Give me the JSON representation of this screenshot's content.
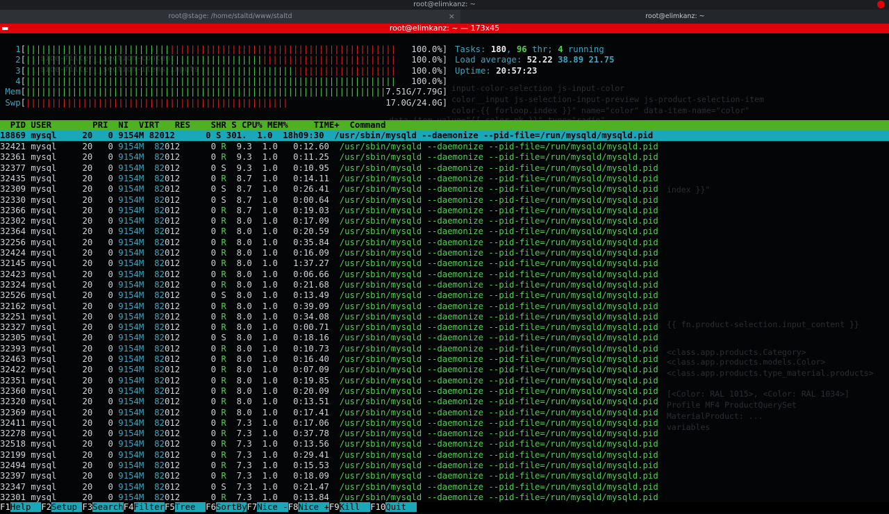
{
  "window_title": "root@elimkanz: ~",
  "tabs": [
    {
      "label": "root@stage: /home/staltd/www/staltd",
      "close": "×"
    },
    {
      "label": "root@elimkanz: ~"
    }
  ],
  "terminal_title": "root@elimkanz: ~ — 173x45",
  "colors": {
    "accent_green": "#4fb024",
    "accent_cyan": "#1aa7b7",
    "title_red": "#e0000a",
    "bar_green": "#4fd04f",
    "bar_red": "#e02222"
  },
  "meters": [
    {
      "label": "1",
      "green_frac": 0.39,
      "total_frac": 1.0,
      "value": "100.0%"
    },
    {
      "label": "2",
      "green_frac": 0.64,
      "total_frac": 1.0,
      "value": "100.0%"
    },
    {
      "label": "3",
      "green_frac": 0.72,
      "total_frac": 1.0,
      "value": "100.0%"
    },
    {
      "label": "4",
      "green_frac": 1.0,
      "total_frac": 1.0,
      "value": "100.0%"
    },
    {
      "label": "Mem",
      "green_frac": 1.0,
      "total_frac": 0.97,
      "value": "7.51G/7.79G"
    },
    {
      "label": "Swp",
      "green_frac": 0.0,
      "total_frac": 0.71,
      "value": "17.0G/24.0G"
    }
  ],
  "stats": {
    "tasks_label": "Tasks: ",
    "tasks": "180",
    "sep1": ", ",
    "thr": "96",
    "thr_label": " thr; ",
    "running": "4",
    "running_label": " running",
    "load_label": "Load average: ",
    "load1": "52.22",
    "load5": "38.89",
    "load15": "21.75",
    "uptime_label": "Uptime: ",
    "uptime": "20:57:23"
  },
  "columns": [
    "PID",
    "USER",
    "PRI",
    "NI",
    "VIRT",
    "RES",
    "SHR",
    "S",
    "CPU%",
    "MEM%",
    "TIME+",
    "Command"
  ],
  "selected": {
    "pid": "18869",
    "user": "mysql",
    "pri": "20",
    "ni": "0",
    "virt": "9154M",
    "res": "82012",
    "shr": "0",
    "s": "S",
    "cpu": "301.",
    "mem": "1.0",
    "time": "18h09:30",
    "cmd": "/usr/sbin/mysqld --daemonize --pid-file=/run/mysqld/mysqld.pid"
  },
  "command": "/usr/sbin/mysqld --daemonize --pid-file=/run/mysqld/mysqld.pid",
  "user": "mysql",
  "pri": "20",
  "ni": "0",
  "virt": "9154M",
  "res_a": "82",
  "res_b": "012",
  "shr": "0",
  "mem": "1.0",
  "processes": [
    {
      "pid": "32421",
      "s": "R",
      "cpu": "9.3",
      "time": "0:12.60"
    },
    {
      "pid": "32361",
      "s": "R",
      "cpu": "9.3",
      "time": "0:11.25"
    },
    {
      "pid": "32377",
      "s": "S",
      "cpu": "9.3",
      "time": "0:10.95"
    },
    {
      "pid": "32435",
      "s": "R",
      "cpu": "8.7",
      "time": "0:14.11"
    },
    {
      "pid": "32309",
      "s": "S",
      "cpu": "8.7",
      "time": "0:26.41"
    },
    {
      "pid": "32330",
      "s": "S",
      "cpu": "8.7",
      "time": "0:00.64"
    },
    {
      "pid": "32366",
      "s": "R",
      "cpu": "8.7",
      "time": "0:19.03"
    },
    {
      "pid": "32302",
      "s": "R",
      "cpu": "8.0",
      "time": "0:17.09"
    },
    {
      "pid": "32364",
      "s": "R",
      "cpu": "8.0",
      "time": "0:20.59"
    },
    {
      "pid": "32256",
      "s": "R",
      "cpu": "8.0",
      "time": "0:35.84"
    },
    {
      "pid": "32424",
      "s": "R",
      "cpu": "8.0",
      "time": "0:16.09"
    },
    {
      "pid": "32145",
      "s": "R",
      "cpu": "8.0",
      "time": "1:37.27"
    },
    {
      "pid": "32423",
      "s": "R",
      "cpu": "8.0",
      "time": "0:06.66"
    },
    {
      "pid": "32324",
      "s": "R",
      "cpu": "8.0",
      "time": "0:21.68"
    },
    {
      "pid": "32526",
      "s": "S",
      "cpu": "8.0",
      "time": "0:13.49"
    },
    {
      "pid": "32162",
      "s": "R",
      "cpu": "8.0",
      "time": "0:39.09"
    },
    {
      "pid": "32251",
      "s": "R",
      "cpu": "8.0",
      "time": "0:34.08"
    },
    {
      "pid": "32327",
      "s": "R",
      "cpu": "8.0",
      "time": "0:00.71"
    },
    {
      "pid": "32305",
      "s": "S",
      "cpu": "8.0",
      "time": "0:18.16"
    },
    {
      "pid": "32393",
      "s": "R",
      "cpu": "8.0",
      "time": "0:10.73"
    },
    {
      "pid": "32463",
      "s": "R",
      "cpu": "8.0",
      "time": "0:16.40"
    },
    {
      "pid": "32422",
      "s": "R",
      "cpu": "8.0",
      "time": "0:07.09"
    },
    {
      "pid": "32351",
      "s": "R",
      "cpu": "8.0",
      "time": "0:19.85"
    },
    {
      "pid": "32360",
      "s": "R",
      "cpu": "8.0",
      "time": "0:20.09"
    },
    {
      "pid": "32320",
      "s": "R",
      "cpu": "8.0",
      "time": "0:13.51"
    },
    {
      "pid": "32369",
      "s": "R",
      "cpu": "8.0",
      "time": "0:17.41"
    },
    {
      "pid": "32411",
      "s": "R",
      "cpu": "7.3",
      "time": "0:17.06"
    },
    {
      "pid": "32278",
      "s": "R",
      "cpu": "7.3",
      "time": "0:37.78"
    },
    {
      "pid": "32518",
      "s": "R",
      "cpu": "7.3",
      "time": "0:13.56"
    },
    {
      "pid": "32199",
      "s": "R",
      "cpu": "7.3",
      "time": "0:29.41"
    },
    {
      "pid": "32494",
      "s": "R",
      "cpu": "7.3",
      "time": "0:15.53"
    },
    {
      "pid": "32397",
      "s": "R",
      "cpu": "7.3",
      "time": "0:18.09"
    },
    {
      "pid": "32347",
      "s": "S",
      "cpu": "7.3",
      "time": "0:21.47"
    },
    {
      "pid": "32301",
      "s": "R",
      "cpu": "7.3",
      "time": "0:13.84"
    }
  ],
  "function_keys": [
    {
      "key": "F1",
      "label": "Help  "
    },
    {
      "key": "F2",
      "label": "Setup "
    },
    {
      "key": "F3",
      "label": "Search"
    },
    {
      "key": "F4",
      "label": "Filter"
    },
    {
      "key": "F5",
      "label": "Tree  "
    },
    {
      "key": "F6",
      "label": "SortBy"
    },
    {
      "key": "F7",
      "label": "Nice -"
    },
    {
      "key": "F8",
      "label": "Nice +"
    },
    {
      "key": "F9",
      "label": "Kill  "
    },
    {
      "key": "F10",
      "label": "Quit  "
    }
  ]
}
